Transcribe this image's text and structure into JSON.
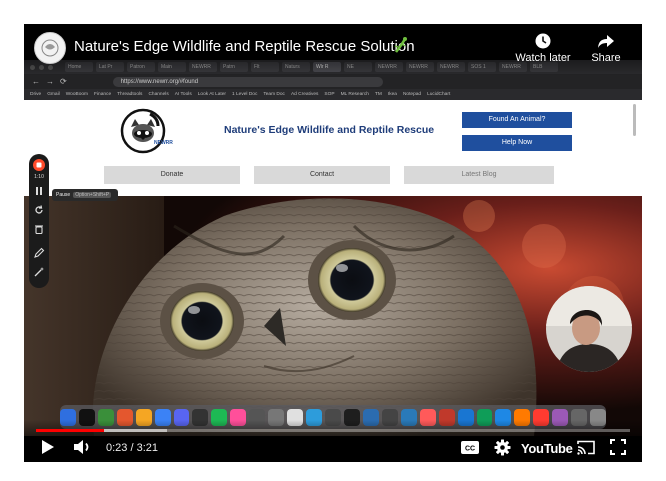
{
  "video": {
    "title": "Nature's Edge Wildlife and Reptile Rescue Solution",
    "watch_later_label": "Watch later",
    "share_label": "Share",
    "time_current": "0:23",
    "time_total": "3:21",
    "time_display": "0:23 / 3:21",
    "progress_played_fraction": 0.114,
    "progress_buffered_fraction": 0.22,
    "youtube_wordmark": "YouTube",
    "accent_color": "#ff0000"
  },
  "browser": {
    "url": "https://www.newrr.org/#found",
    "tabs": [
      "Home",
      "Lat Pr",
      "Patron",
      "Main",
      "NEWRR",
      "Patrn",
      "Flt",
      "Naturs",
      "Wlr R",
      "NE",
      "NEWRR",
      "NEWRR",
      "NEWRR",
      "SOS 1",
      "NEWRR",
      "BLB"
    ],
    "bookmarks": [
      "Drive",
      "Gmail",
      "WooBoom",
      "Finance",
      "Threadtools",
      "Channels",
      "AI Tools",
      "Look At Later",
      "1 Level Doc",
      "Team Doc",
      "Ad Creatives",
      "SOP",
      "ML Research",
      "TM",
      "Ikea",
      "Notepad",
      "LucidChart"
    ]
  },
  "website": {
    "site_name": "Nature's Edge Wildlife and Reptile Rescue",
    "logo_text": "NEWRR",
    "found_animal_label": "Found An Animal?",
    "help_now_label": "Help Now",
    "nav": [
      "Donate",
      "Contact",
      "Latest Blog"
    ]
  },
  "loom": {
    "elapsed": "1:10",
    "pause_label": "Pause",
    "pause_shortcut": "Option+Shift+P"
  }
}
